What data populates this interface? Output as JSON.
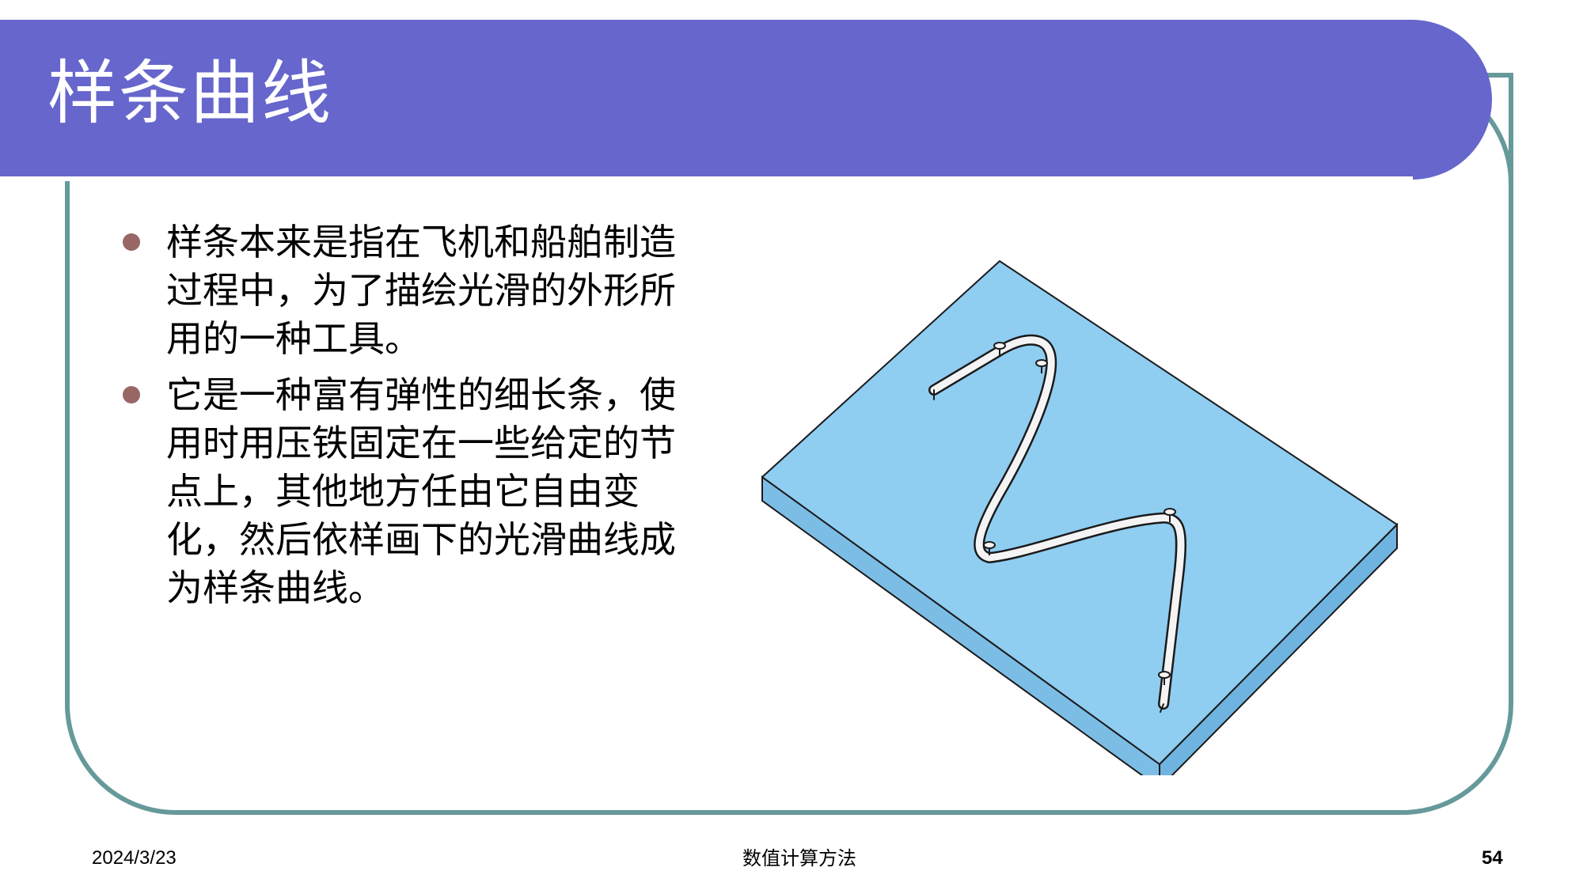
{
  "slide": {
    "title": "样条曲线",
    "bullets": [
      "样条本来是指在飞机和船舶制造过程中，为了描绘光滑的外形所用的一种工具。",
      "它是一种富有弹性的细长条，使用时用压铁固定在一些给定的节点上，其他地方任由它自由变化，然后依样画下的光滑曲线成为样条曲线。"
    ]
  },
  "footer": {
    "date": "2024/3/23",
    "center": "数值计算方法",
    "page": "54"
  },
  "colors": {
    "title_bar": "#6666cc",
    "frame": "#66999a",
    "bullet": "#996666",
    "board_top": "#8fcdf1",
    "board_side": "#7cbde6"
  }
}
